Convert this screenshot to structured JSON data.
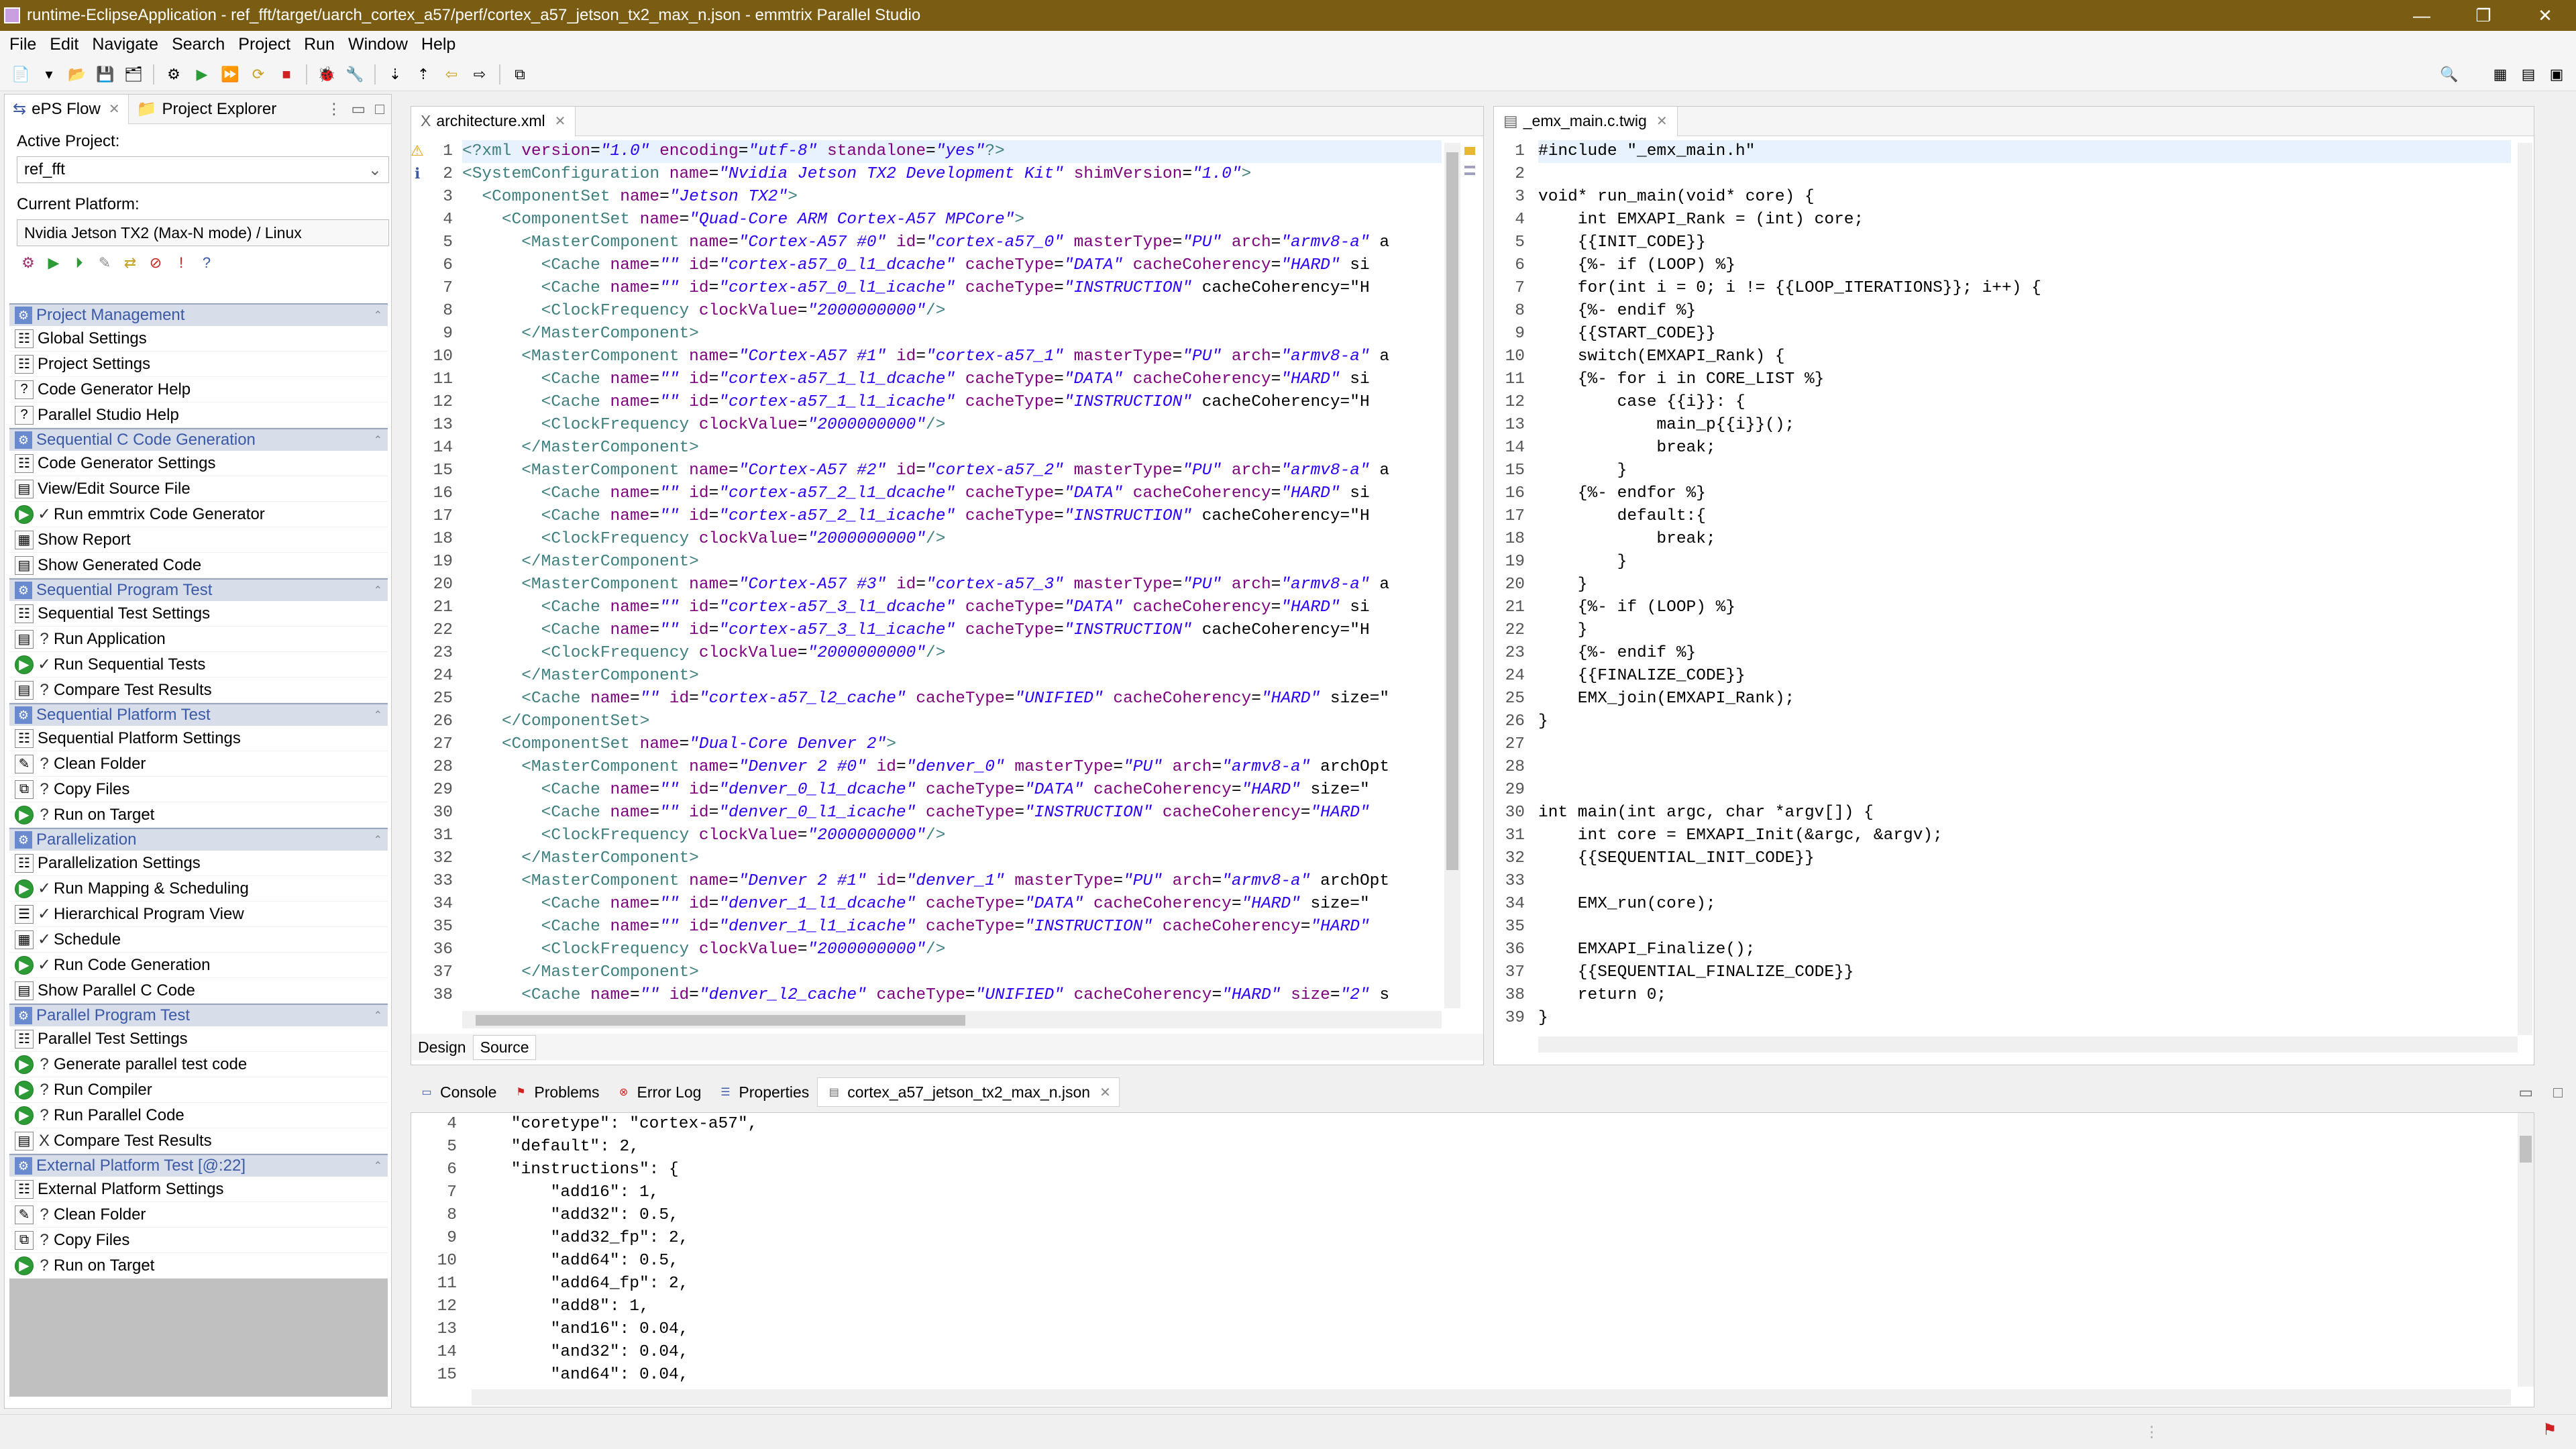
{
  "window": {
    "title": "runtime-EclipseApplication - ref_fft/target/uarch_cortex_a57/perf/cortex_a57_jetson_tx2_max_n.json - emmtrix Parallel Studio",
    "minimize": "—",
    "restore": "❐",
    "close": "✕"
  },
  "menu": [
    "File",
    "Edit",
    "Navigate",
    "Search",
    "Project",
    "Run",
    "Window",
    "Help"
  ],
  "left_panel": {
    "tabs": [
      {
        "label": "ePS Flow",
        "icon": "eps-flow-icon",
        "active": true
      },
      {
        "label": "Project Explorer",
        "icon": "project-explorer-icon",
        "active": false
      }
    ],
    "active_project_label": "Active Project:",
    "active_project_value": "ref_fft",
    "current_platform_label": "Current Platform:",
    "current_platform_value": "Nvidia Jetson TX2 (Max-N mode) / Linux",
    "sections": [
      {
        "title": "Project Management",
        "items": [
          {
            "label": "Global Settings",
            "prefix": "",
            "icon": "settings"
          },
          {
            "label": "Project Settings",
            "prefix": "",
            "icon": "settings"
          },
          {
            "label": "Code Generator Help",
            "prefix": "",
            "icon": "help"
          },
          {
            "label": "Parallel Studio Help",
            "prefix": "",
            "icon": "help"
          }
        ]
      },
      {
        "title": "Sequential C Code Generation",
        "items": [
          {
            "label": "Code Generator Settings",
            "prefix": "",
            "icon": "settings"
          },
          {
            "label": "View/Edit Source File",
            "prefix": "",
            "icon": "file"
          },
          {
            "label": "Run emmtrix Code Generator",
            "prefix": "✓",
            "icon": "run"
          },
          {
            "label": "Show Report",
            "prefix": "",
            "icon": "report"
          },
          {
            "label": "Show Generated Code",
            "prefix": "",
            "icon": "file"
          }
        ]
      },
      {
        "title": "Sequential Program Test",
        "items": [
          {
            "label": "Sequential Test Settings",
            "prefix": "",
            "icon": "settings"
          },
          {
            "label": "Run Application",
            "prefix": "?",
            "icon": "file"
          },
          {
            "label": "Run Sequential Tests",
            "prefix": "✓",
            "icon": "run"
          },
          {
            "label": "Compare Test Results",
            "prefix": "?",
            "icon": "file"
          }
        ]
      },
      {
        "title": "Sequential Platform Test",
        "items": [
          {
            "label": "Sequential Platform Settings",
            "prefix": "",
            "icon": "settings"
          },
          {
            "label": "Clean Folder",
            "prefix": "?",
            "icon": "clean"
          },
          {
            "label": "Copy Files",
            "prefix": "?",
            "icon": "copy"
          },
          {
            "label": "Run on Target",
            "prefix": "?",
            "icon": "run"
          }
        ]
      },
      {
        "title": "Parallelization",
        "items": [
          {
            "label": "Parallelization Settings",
            "prefix": "",
            "icon": "settings"
          },
          {
            "label": "Run Mapping & Scheduling",
            "prefix": "✓",
            "icon": "run"
          },
          {
            "label": "Hierarchical Program View",
            "prefix": "✓",
            "icon": "tree"
          },
          {
            "label": "Schedule",
            "prefix": "✓",
            "icon": "report"
          },
          {
            "label": "Run Code Generation",
            "prefix": "✓",
            "icon": "run"
          },
          {
            "label": "Show Parallel C Code",
            "prefix": "",
            "icon": "file"
          }
        ]
      },
      {
        "title": "Parallel Program Test",
        "items": [
          {
            "label": "Parallel Test Settings",
            "prefix": "",
            "icon": "settings"
          },
          {
            "label": "Generate parallel test code",
            "prefix": "?",
            "icon": "run"
          },
          {
            "label": "Run Compiler",
            "prefix": "?",
            "icon": "run"
          },
          {
            "label": "Run Parallel Code",
            "prefix": "?",
            "icon": "run"
          },
          {
            "label": "Compare Test Results",
            "prefix": "X",
            "icon": "file"
          }
        ]
      },
      {
        "title": "External Platform Test [@:22]",
        "items": [
          {
            "label": "External Platform Settings",
            "prefix": "",
            "icon": "settings"
          },
          {
            "label": "Clean Folder",
            "prefix": "?",
            "icon": "clean"
          },
          {
            "label": "Copy Files",
            "prefix": "?",
            "icon": "copy"
          },
          {
            "label": "Run on Target",
            "prefix": "?",
            "icon": "run"
          }
        ]
      }
    ]
  },
  "xml_editor": {
    "tab": "architecture.xml",
    "design_tab": "Design",
    "source_tab": "Source",
    "line_numbers": [
      "1",
      "2",
      "3",
      "4",
      "5",
      "6",
      "7",
      "8",
      "9",
      "10",
      "11",
      "12",
      "13",
      "14",
      "15",
      "16",
      "17",
      "18",
      "19",
      "20",
      "21",
      "22",
      "23",
      "24",
      "25",
      "26",
      "27",
      "28",
      "29",
      "30",
      "31",
      "32",
      "33",
      "34",
      "35",
      "36",
      "37",
      "38"
    ],
    "lines": [
      "<?xml version=\"1.0\" encoding=\"utf-8\" standalone=\"yes\"?>",
      "<SystemConfiguration name=\"Nvidia Jetson TX2 Development Kit\" shimVersion=\"1.0\">",
      "  <ComponentSet name=\"Jetson TX2\">",
      "    <ComponentSet name=\"Quad-Core ARM Cortex-A57 MPCore\">",
      "      <MasterComponent name=\"Cortex-A57 #0\" id=\"cortex-a57_0\" masterType=\"PU\" arch=\"armv8-a\" a",
      "        <Cache name=\"\" id=\"cortex-a57_0_l1_dcache\" cacheType=\"DATA\" cacheCoherency=\"HARD\" si",
      "        <Cache name=\"\" id=\"cortex-a57_0_l1_icache\" cacheType=\"INSTRUCTION\" cacheCoherency=\"H",
      "        <ClockFrequency clockValue=\"2000000000\"/>",
      "      </MasterComponent>",
      "      <MasterComponent name=\"Cortex-A57 #1\" id=\"cortex-a57_1\" masterType=\"PU\" arch=\"armv8-a\" a",
      "        <Cache name=\"\" id=\"cortex-a57_1_l1_dcache\" cacheType=\"DATA\" cacheCoherency=\"HARD\" si",
      "        <Cache name=\"\" id=\"cortex-a57_1_l1_icache\" cacheType=\"INSTRUCTION\" cacheCoherency=\"H",
      "        <ClockFrequency clockValue=\"2000000000\"/>",
      "      </MasterComponent>",
      "      <MasterComponent name=\"Cortex-A57 #2\" id=\"cortex-a57_2\" masterType=\"PU\" arch=\"armv8-a\" a",
      "        <Cache name=\"\" id=\"cortex-a57_2_l1_dcache\" cacheType=\"DATA\" cacheCoherency=\"HARD\" si",
      "        <Cache name=\"\" id=\"cortex-a57_2_l1_icache\" cacheType=\"INSTRUCTION\" cacheCoherency=\"H",
      "        <ClockFrequency clockValue=\"2000000000\"/>",
      "      </MasterComponent>",
      "      <MasterComponent name=\"Cortex-A57 #3\" id=\"cortex-a57_3\" masterType=\"PU\" arch=\"armv8-a\" a",
      "        <Cache name=\"\" id=\"cortex-a57_3_l1_dcache\" cacheType=\"DATA\" cacheCoherency=\"HARD\" si",
      "        <Cache name=\"\" id=\"cortex-a57_3_l1_icache\" cacheType=\"INSTRUCTION\" cacheCoherency=\"H",
      "        <ClockFrequency clockValue=\"2000000000\"/>",
      "      </MasterComponent>",
      "      <Cache name=\"\" id=\"cortex-a57_l2_cache\" cacheType=\"UNIFIED\" cacheCoherency=\"HARD\" size=\"",
      "    </ComponentSet>",
      "    <ComponentSet name=\"Dual-Core Denver 2\">",
      "      <MasterComponent name=\"Denver 2 #0\" id=\"denver_0\" masterType=\"PU\" arch=\"armv8-a\" archOpt",
      "        <Cache name=\"\" id=\"denver_0_l1_dcache\" cacheType=\"DATA\" cacheCoherency=\"HARD\" size=\"",
      "        <Cache name=\"\" id=\"denver_0_l1_icache\" cacheType=\"INSTRUCTION\" cacheCoherency=\"HARD\"",
      "        <ClockFrequency clockValue=\"2000000000\"/>",
      "      </MasterComponent>",
      "      <MasterComponent name=\"Denver 2 #1\" id=\"denver_1\" masterType=\"PU\" arch=\"armv8-a\" archOpt",
      "        <Cache name=\"\" id=\"denver_1_l1_dcache\" cacheType=\"DATA\" cacheCoherency=\"HARD\" size=\"",
      "        <Cache name=\"\" id=\"denver_1_l1_icache\" cacheType=\"INSTRUCTION\" cacheCoherency=\"HARD\"",
      "        <ClockFrequency clockValue=\"2000000000\"/>",
      "      </MasterComponent>",
      "      <Cache name=\"\" id=\"denver_l2_cache\" cacheType=\"UNIFIED\" cacheCoherency=\"HARD\" size=\"2\" s"
    ]
  },
  "twig_editor": {
    "tab": "_emx_main.c.twig",
    "line_numbers": [
      "1",
      "2",
      "3",
      "4",
      "5",
      "6",
      "7",
      "8",
      "9",
      "10",
      "11",
      "12",
      "13",
      "14",
      "15",
      "16",
      "17",
      "18",
      "19",
      "20",
      "21",
      "22",
      "23",
      "24",
      "25",
      "26",
      "27",
      "28",
      "29",
      "30",
      "31",
      "32",
      "33",
      "34",
      "35",
      "36",
      "37",
      "38",
      "39"
    ],
    "lines": [
      "#include \"_emx_main.h\"",
      "",
      "void* run_main(void* core) {",
      "    int EMXAPI_Rank = (int) core;",
      "    {{INIT_CODE}}",
      "    {%- if (LOOP) %}",
      "    for(int i = 0; i != {{LOOP_ITERATIONS}}; i++) {",
      "    {%- endif %}",
      "    {{START_CODE}}",
      "    switch(EMXAPI_Rank) {",
      "    {%- for i in CORE_LIST %}",
      "        case {{i}}: {",
      "            main_p{{i}}();",
      "            break;",
      "        }",
      "    {%- endfor %}",
      "        default:{",
      "            break;",
      "        }",
      "    }",
      "    {%- if (LOOP) %}",
      "    }",
      "    {%- endif %}",
      "    {{FINALIZE_CODE}}",
      "    EMX_join(EMXAPI_Rank);",
      "}",
      "",
      "",
      "",
      "int main(int argc, char *argv[]) {",
      "    int core = EMXAPI_Init(&argc, &argv);",
      "    {{SEQUENTIAL_INIT_CODE}}",
      "",
      "    EMX_run(core);",
      "",
      "    EMXAPI_Finalize();",
      "    {{SEQUENTIAL_FINALIZE_CODE}}",
      "    return 0;",
      "}"
    ]
  },
  "bottom": {
    "tabs": [
      {
        "label": "Console",
        "icon": "console-icon"
      },
      {
        "label": "Problems",
        "icon": "problems-icon"
      },
      {
        "label": "Error Log",
        "icon": "error-log-icon"
      },
      {
        "label": "Properties",
        "icon": "properties-icon"
      },
      {
        "label": "cortex_a57_jetson_tx2_max_n.json",
        "icon": "json-file-icon"
      }
    ],
    "line_numbers": [
      "4",
      "5",
      "6",
      "7",
      "8",
      "9",
      "10",
      "11",
      "12",
      "13",
      "14",
      "15"
    ],
    "lines": [
      "    \"coretype\": \"cortex-a57\",",
      "    \"default\": 2,",
      "    \"instructions\": {",
      "        \"add16\": 1,",
      "        \"add32\": 0.5,",
      "        \"add32_fp\": 2,",
      "        \"add64\": 0.5,",
      "        \"add64_fp\": 2,",
      "        \"add8\": 1,",
      "        \"and16\": 0.04,",
      "        \"and32\": 0.04,",
      "        \"and64\": 0.04,"
    ]
  },
  "colors": {
    "titlebar": "#7a5c12",
    "section_header": "#3a5aa8",
    "xml_tag": "#3f7f7f",
    "xml_attr": "#7f007f",
    "xml_value": "#2a00ff",
    "run_icon": "#2c9a35"
  }
}
